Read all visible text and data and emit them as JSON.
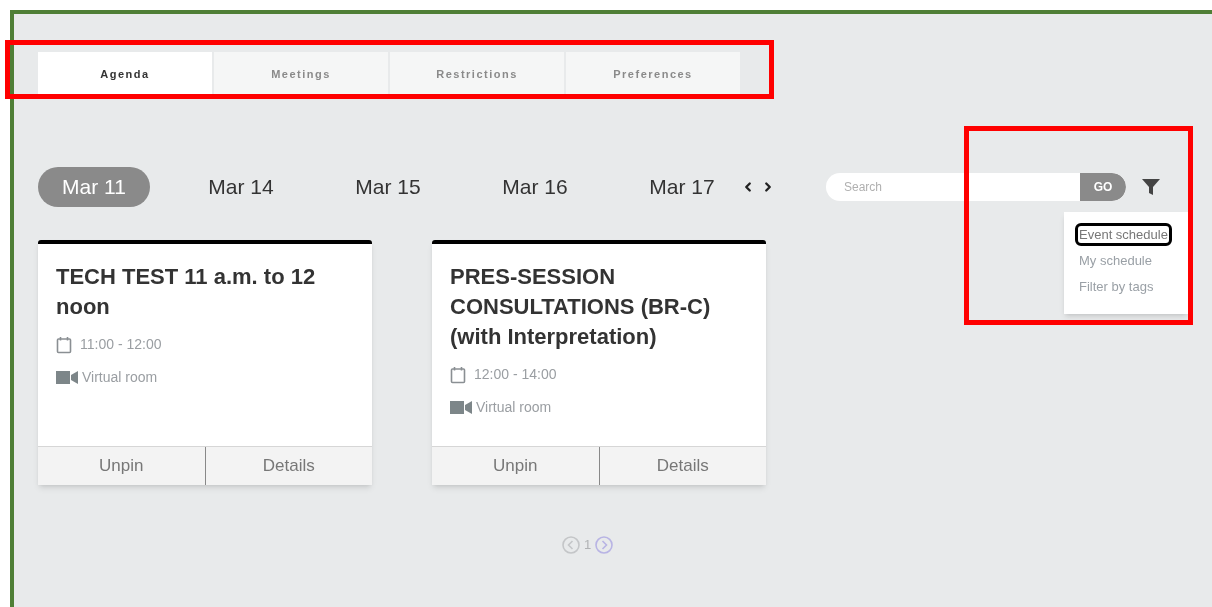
{
  "tabs": [
    {
      "label": "Agenda",
      "selected": true
    },
    {
      "label": "Meetings",
      "selected": false
    },
    {
      "label": "Restrictions",
      "selected": false
    },
    {
      "label": "Preferences",
      "selected": false
    }
  ],
  "dates": [
    {
      "label": "Mar 11",
      "selected": true
    },
    {
      "label": "Mar 14",
      "selected": false
    },
    {
      "label": "Mar 15",
      "selected": false
    },
    {
      "label": "Mar 16",
      "selected": false
    },
    {
      "label": "Mar 17",
      "selected": false
    }
  ],
  "search": {
    "placeholder": "Search",
    "button": "GO"
  },
  "filter_menu": [
    {
      "label": "Event schedule",
      "selected": true
    },
    {
      "label": "My schedule",
      "selected": false
    },
    {
      "label": "Filter by tags",
      "selected": false
    }
  ],
  "cards": [
    {
      "title": "TECH TEST 11 a.m. to 12 noon",
      "time": "11:00 - 12:00",
      "room": "Virtual room",
      "actions": [
        "Unpin",
        "Details"
      ]
    },
    {
      "title": "PRES-SESSION CONSULTATIONS (BR-C) (with Interpretation)",
      "time": "12:00 - 14:00",
      "room": "Virtual room",
      "actions": [
        "Unpin",
        "Details"
      ]
    }
  ],
  "pagination": {
    "page": "1"
  }
}
